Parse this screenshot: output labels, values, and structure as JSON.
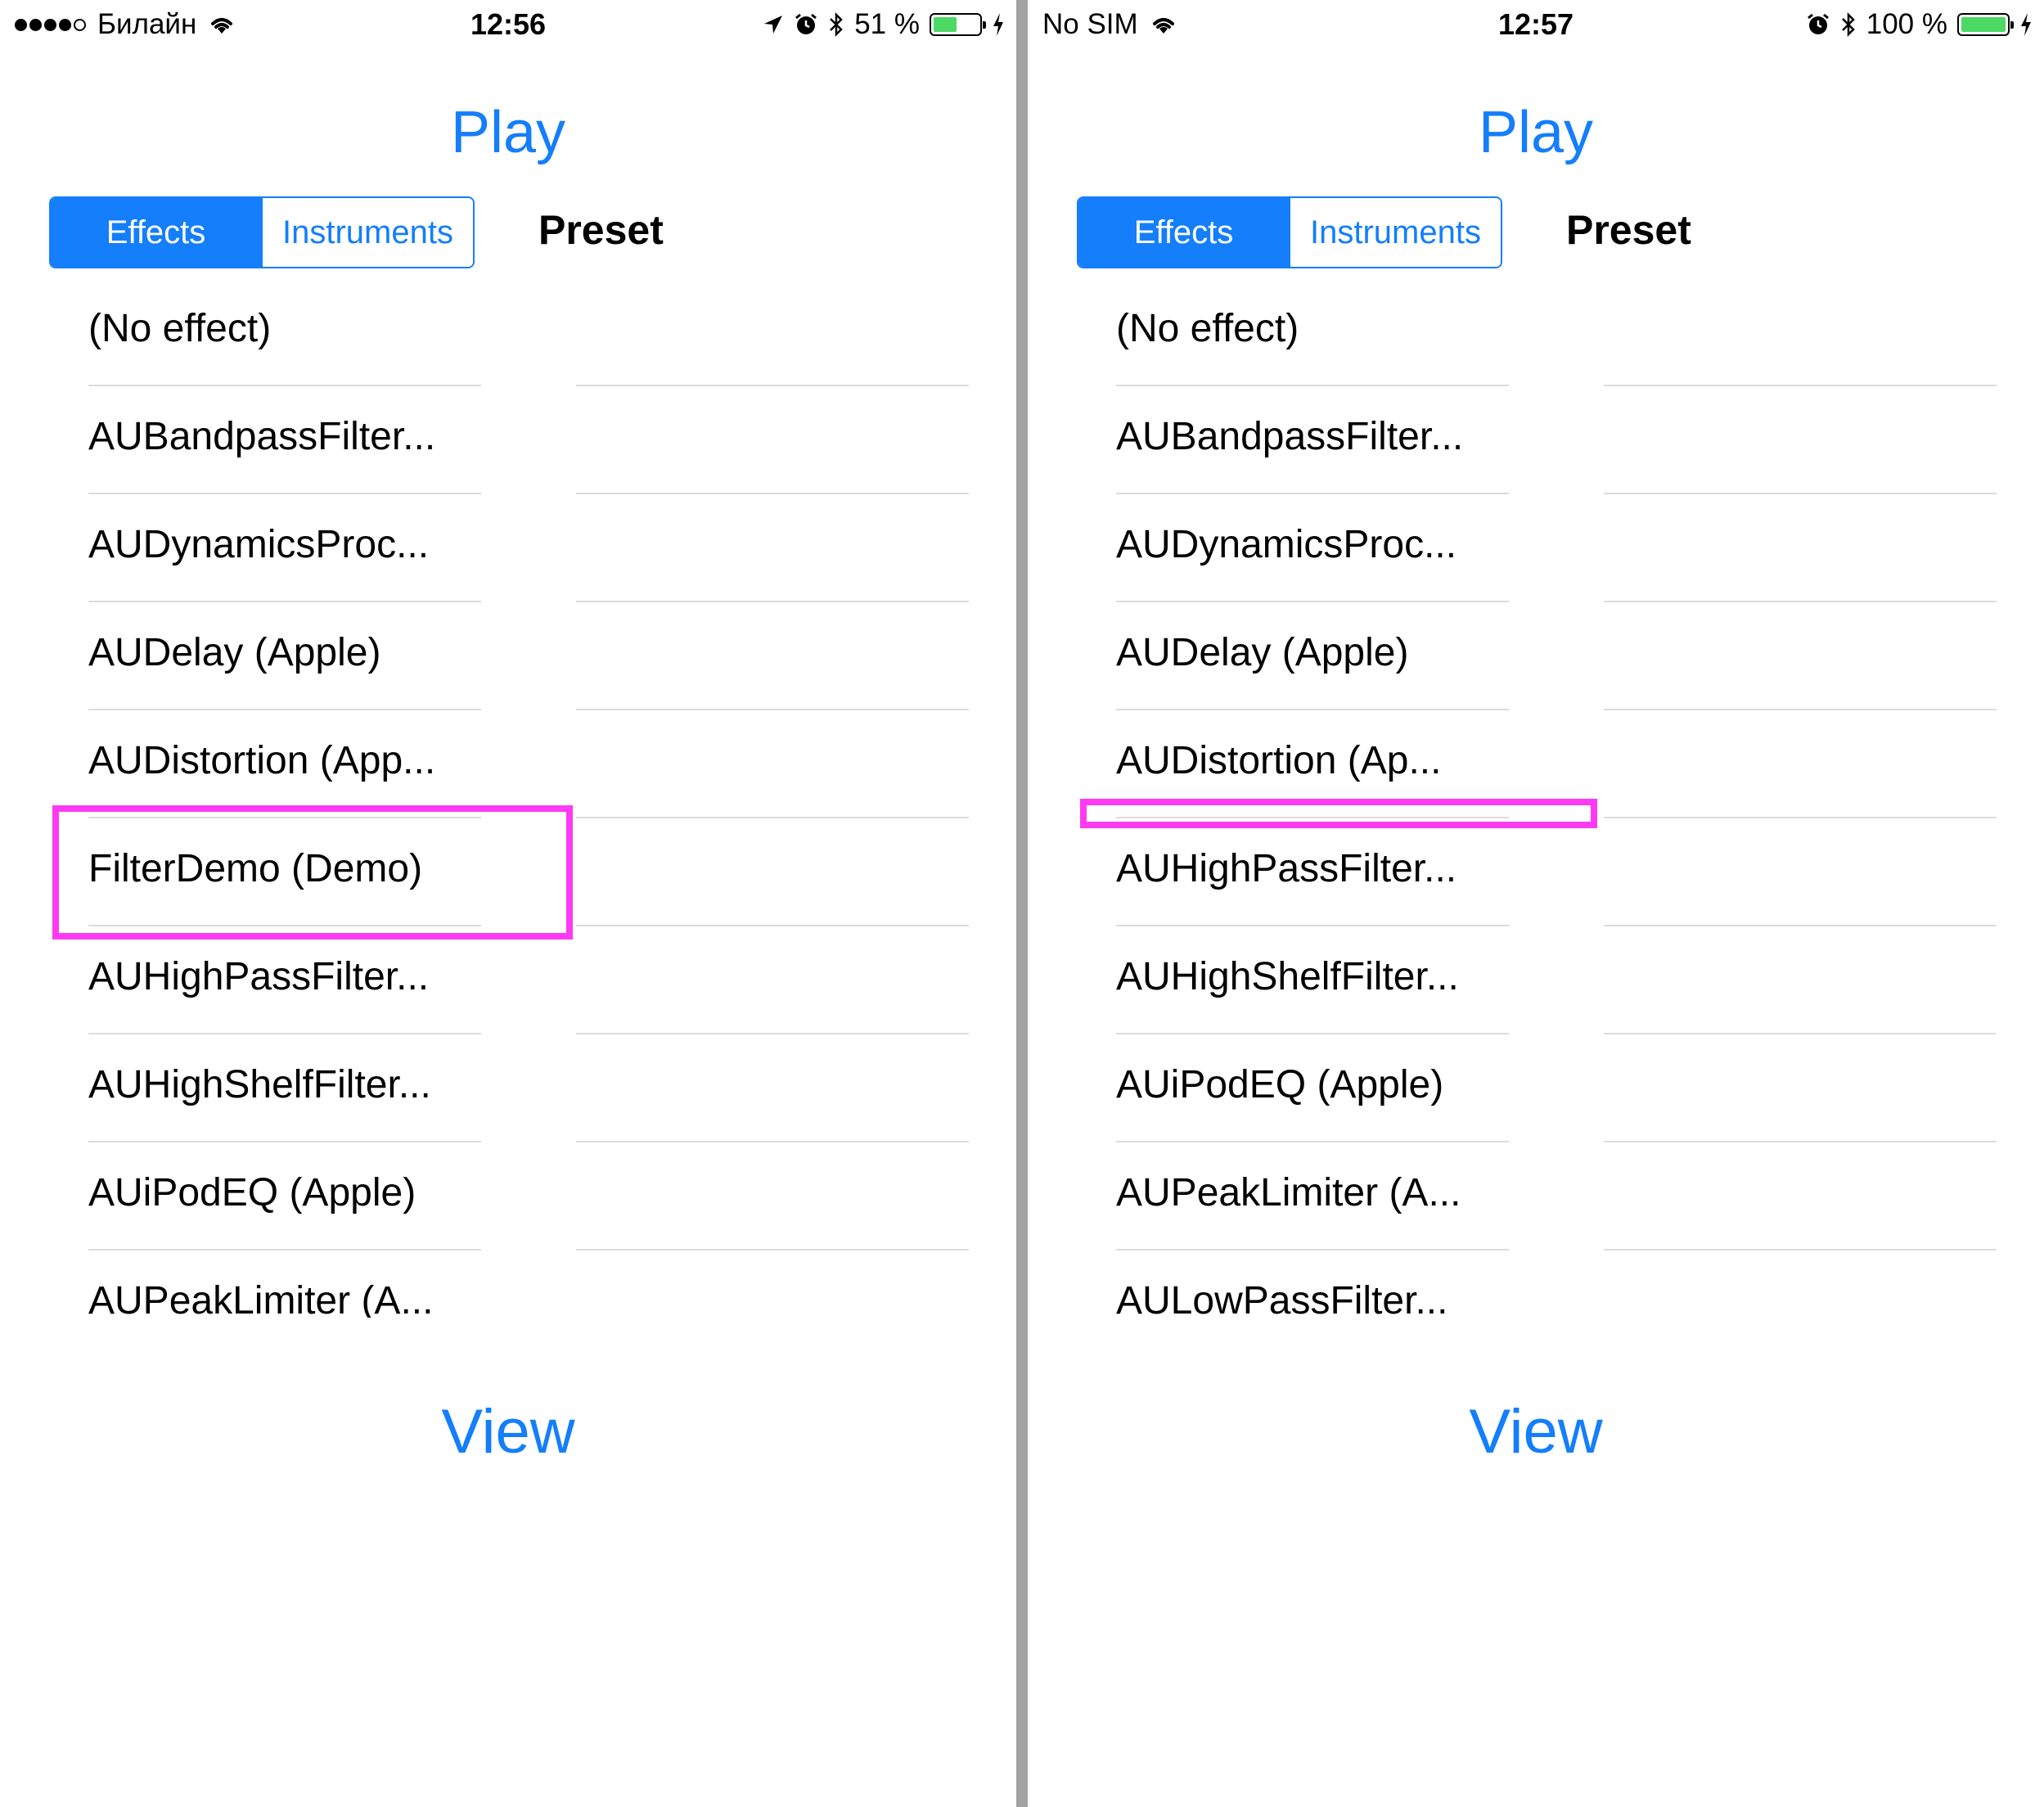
{
  "screens": [
    {
      "status": {
        "carrier": "Билайн",
        "time": "12:56",
        "battery_text": "51 %",
        "battery_level": 0.51,
        "icons": [
          "signal-dots",
          "wifi-icon",
          "location-arrow-icon",
          "alarm-icon",
          "bluetooth-icon",
          "battery-icon",
          "charging-bolt-icon"
        ]
      },
      "title": "Play",
      "segments": [
        "Effects",
        "Instruments"
      ],
      "selected_segment": "Effects",
      "preset_label": "Preset",
      "effects": [
        "(No effect)",
        "AUBandpassFilter...",
        "AUDynamicsProc...",
        "AUDelay (Apple)",
        "AUDistortion (App...",
        "FilterDemo (Demo)",
        "AUHighPassFilter...",
        "AUHighShelfFilter...",
        "AUiPodEQ (Apple)",
        "AUPeakLimiter (A..."
      ],
      "highlighted_item": "FilterDemo (Demo)",
      "view_button": "View",
      "highlight_color": "#ff3af2"
    },
    {
      "status": {
        "carrier": "No SIM",
        "time": "12:57",
        "battery_text": "100 %",
        "battery_level": 1.0,
        "icons": [
          "wifi-icon",
          "alarm-icon",
          "bluetooth-icon",
          "battery-icon",
          "charging-bolt-icon"
        ]
      },
      "title": "Play",
      "segments": [
        "Effects",
        "Instruments"
      ],
      "selected_segment": "Effects",
      "preset_label": "Preset",
      "effects": [
        "(No effect)",
        "AUBandpassFilter...",
        "AUDynamicsProc...",
        "AUDelay (Apple)",
        "AUDistortion (Ap...",
        "AUHighPassFilter...",
        "AUHighShelfFilter...",
        "AUiPodEQ (Apple)",
        "AUPeakLimiter (A...",
        "AULowPassFilter..."
      ],
      "highlighted_item": "",
      "view_button": "View",
      "highlight_color": "#ff3af2"
    }
  ],
  "colors": {
    "accent": "#147efb",
    "battery_green": "#4cd964",
    "separator": "#dcdcdc",
    "divider": "#a3a3a3"
  }
}
